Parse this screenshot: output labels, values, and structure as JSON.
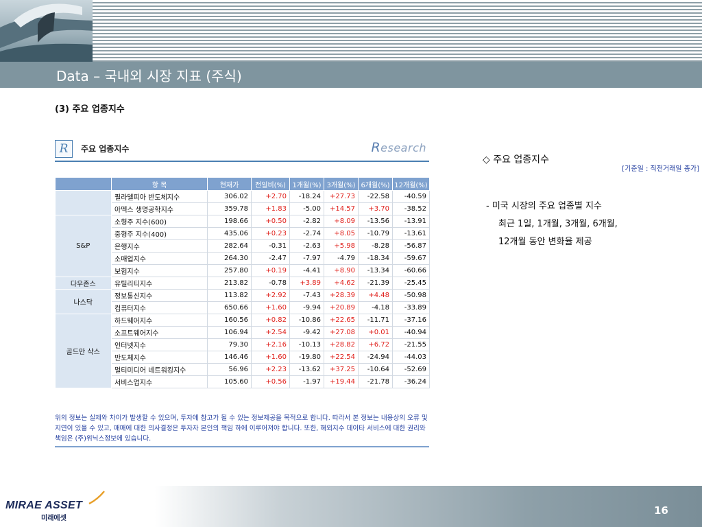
{
  "header": {
    "title": "Data – 국내외 시장 지표 (주식)"
  },
  "section_heading": "(3) 주요 업종지수",
  "panel": {
    "logo_letter": "R",
    "title": "주요 업종지수",
    "research_cap": "R",
    "research_rest": "esearch",
    "basis_note": "[기준일 : 직전거래일 종가]"
  },
  "table": {
    "columns": [
      "항  목",
      "현재가",
      "전일비(%)",
      "1개월(%)",
      "3개월(%)",
      "6개월(%)",
      "12개월(%)"
    ],
    "groups": [
      {
        "label": "",
        "rowspan": 2,
        "rows": [
          {
            "name": "필라델피아 반도체지수",
            "cur": "306.02",
            "d1": "+2.70",
            "m1": "-18.24",
            "m3": "+27.73",
            "m6": "-22.58",
            "m12": "-40.59"
          },
          {
            "name": "아멕스 생명공학지수",
            "cur": "359.78",
            "d1": "+1.83",
            "m1": "-5.00",
            "m3": "+14.57",
            "m6": "+3.70",
            "m12": "-38.52"
          }
        ]
      },
      {
        "label": "S&P",
        "rowspan": 5,
        "rows": [
          {
            "name": "소형주 지수(600)",
            "cur": "198.66",
            "d1": "+0.50",
            "m1": "-2.82",
            "m3": "+8.09",
            "m6": "-13.56",
            "m12": "-13.91"
          },
          {
            "name": "중형주 지수(400)",
            "cur": "435.06",
            "d1": "+0.23",
            "m1": "-2.74",
            "m3": "+8.05",
            "m6": "-10.79",
            "m12": "-13.61"
          },
          {
            "name": "은행지수",
            "cur": "282.64",
            "d1": "-0.31",
            "m1": "-2.63",
            "m3": "+5.98",
            "m6": "-8.28",
            "m12": "-56.87"
          },
          {
            "name": "소매업지수",
            "cur": "264.30",
            "d1": "-2.47",
            "m1": "-7.97",
            "m3": "-4.79",
            "m6": "-18.34",
            "m12": "-59.67"
          },
          {
            "name": "보험지수",
            "cur": "257.80",
            "d1": "+0.19",
            "m1": "-4.41",
            "m3": "+8.90",
            "m6": "-13.34",
            "m12": "-60.66"
          }
        ]
      },
      {
        "label": "다우존스",
        "rowspan": 1,
        "rows": [
          {
            "name": "유틸리티지수",
            "cur": "213.82",
            "d1": "-0.78",
            "m1": "+3.89",
            "m3": "+4.62",
            "m6": "-21.39",
            "m12": "-25.45"
          }
        ]
      },
      {
        "label": "나스닥",
        "rowspan": 2,
        "rows": [
          {
            "name": "정보통신지수",
            "cur": "113.82",
            "d1": "+2.92",
            "m1": "-7.43",
            "m3": "+28.39",
            "m6": "+4.48",
            "m12": "-50.98"
          },
          {
            "name": "컴퓨터지수",
            "cur": "650.66",
            "d1": "+1.60",
            "m1": "-9.94",
            "m3": "+20.89",
            "m6": "-4.18",
            "m12": "-33.89"
          }
        ]
      },
      {
        "label": "골드만 삭스",
        "rowspan": 6,
        "rows": [
          {
            "name": "하드웨어지수",
            "cur": "160.56",
            "d1": "+0.82",
            "m1": "-10.86",
            "m3": "+22.65",
            "m6": "-11.71",
            "m12": "-37.16"
          },
          {
            "name": "소프트웨어지수",
            "cur": "106.94",
            "d1": "+2.54",
            "m1": "-9.42",
            "m3": "+27.08",
            "m6": "+0.01",
            "m12": "-40.94"
          },
          {
            "name": "인터넷지수",
            "cur": "79.30",
            "d1": "+2.16",
            "m1": "-10.13",
            "m3": "+28.82",
            "m6": "+6.72",
            "m12": "-21.55"
          },
          {
            "name": "반도체지수",
            "cur": "146.46",
            "d1": "+1.60",
            "m1": "-19.80",
            "m3": "+22.54",
            "m6": "-24.94",
            "m12": "-44.03"
          },
          {
            "name": "멀티미디어 네트워킹지수",
            "cur": "56.96",
            "d1": "+2.23",
            "m1": "-13.62",
            "m3": "+37.25",
            "m6": "-10.64",
            "m12": "-52.69"
          },
          {
            "name": "서비스업지수",
            "cur": "105.60",
            "d1": "+0.56",
            "m1": "-1.97",
            "m3": "+19.44",
            "m6": "-21.78",
            "m12": "-36.24"
          }
        ]
      }
    ]
  },
  "disclaimer": "위의 정보는 실제와 차이가 발생할 수 있으며, 투자에 참고가 될 수 있는 정보제공을 목적으로 합니다. 따라서 본 정보는 내용상의 오류 및 지연이 있을 수 있고, 매매에 대한 의사결정은 투자자 본인의 책임 하에 이루어져야 합니다. 또한, 해외지수 데이타 서비스에 대한 권리와 책임은 (주)위닉스정보에 있습니다.",
  "side": {
    "heading": "◇ 주요 업종지수",
    "line1": "- 미국 시장의 주요 업종별 지수",
    "line2": "최근 1일, 1개월, 3개월, 6개월,",
    "line3": "12개월 동안 변화율 제공"
  },
  "footer": {
    "logo": "MIRAE ASSET",
    "logo_sub": "미래에셋",
    "page": "16"
  },
  "colors": {
    "header_bar": "#7f959f",
    "table_header": "#7fa2cf",
    "positive": "#e0201b",
    "note_blue": "#1f3b9e"
  }
}
